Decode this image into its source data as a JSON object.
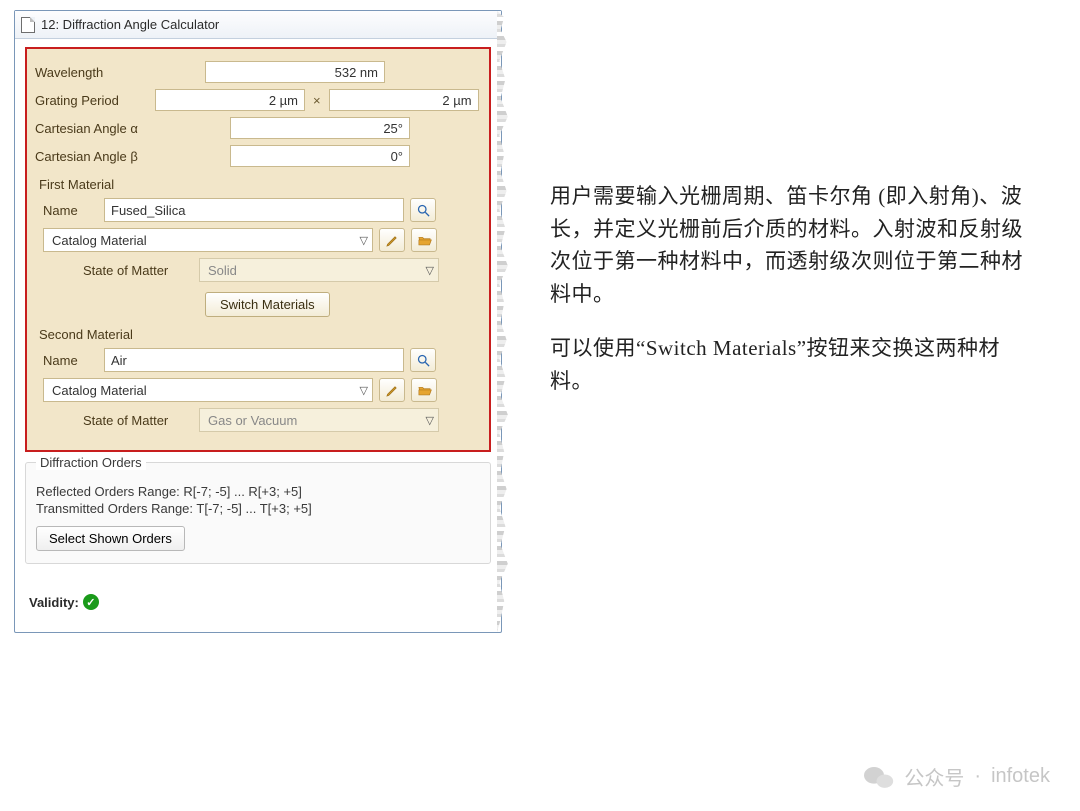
{
  "window": {
    "title": "12: Diffraction Angle Calculator"
  },
  "fields": {
    "wavelength_label": "Wavelength",
    "wavelength_value": "532 nm",
    "period_label": "Grating Period",
    "period_x": "2 µm",
    "period_times": "×",
    "period_y": "2 µm",
    "alpha_label": "Cartesian Angle α",
    "alpha_value": "25°",
    "beta_label": "Cartesian Angle β",
    "beta_value": "0°"
  },
  "first_material": {
    "section_label": "First Material",
    "name_label": "Name",
    "name_value": "Fused_Silica",
    "catalog_label": "Catalog Material",
    "state_label": "State of Matter",
    "state_value": "Solid"
  },
  "switch_label": "Switch Materials",
  "second_material": {
    "section_label": "Second Material",
    "name_label": "Name",
    "name_value": "Air",
    "catalog_label": "Catalog Material",
    "state_label": "State of Matter",
    "state_value": "Gas or Vacuum"
  },
  "orders": {
    "section_label": "Diffraction Orders",
    "reflected": "Reflected Orders Range: R[-7; -5] ... R[+3; +5]",
    "transmitted": "Transmitted Orders Range: T[-7; -5] ... T[+3; +5]",
    "button": "Select Shown Orders"
  },
  "validity_label": "Validity:",
  "side": {
    "p1": "用户需要输入光栅周期、笛卡尔角 (即入射角)、波长，并定义光栅前后介质的材料。入射波和反射级次位于第一种材料中，而透射级次则位于第二种材料中。",
    "p2": "可以使用“Switch Materials”按钮来交换这两种材料。"
  },
  "watermark": {
    "label": "公众号",
    "dot": "·",
    "name": "infotek"
  }
}
